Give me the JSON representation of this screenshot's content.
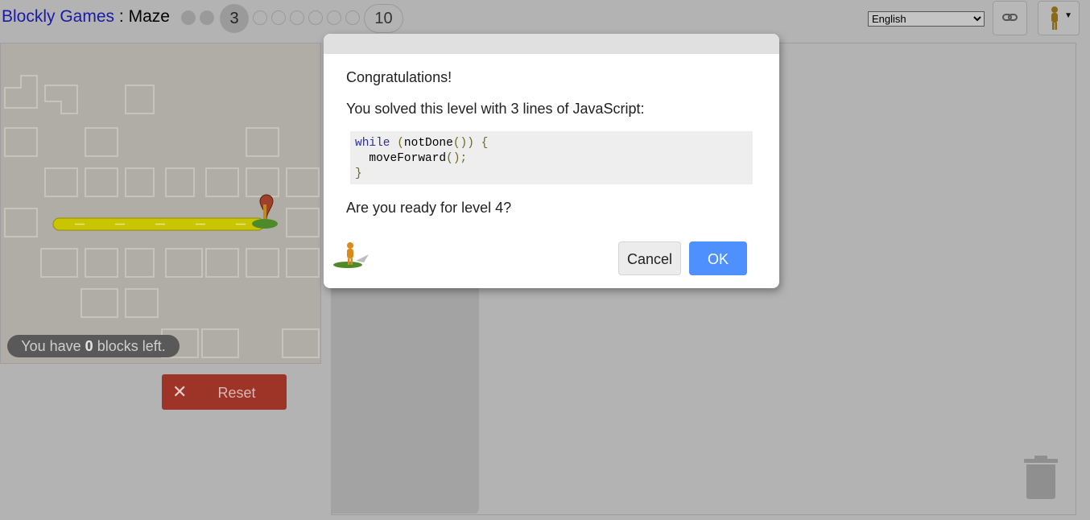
{
  "header": {
    "app_name": "Blockly Games",
    "separator": ":",
    "game_name": "Maze",
    "current_level": "3",
    "last_level": "10",
    "language_selected": "English"
  },
  "icons": {
    "link": "link-icon",
    "pegman": "pegman-icon",
    "trash": "trash-icon",
    "reset": "x-icon"
  },
  "maze": {
    "blocks_left_prefix": "You have",
    "blocks_left_count": "0",
    "blocks_left_suffix": "blocks left."
  },
  "controls": {
    "reset_label": "Reset"
  },
  "dialog": {
    "congrats": "Congratulations!",
    "solved": "You solved this level with 3 lines of JavaScript:",
    "code": {
      "kw_while": "while",
      "cond_open": "(",
      "cond_call": "notDone",
      "cond_parens": "()",
      "cond_close": ")",
      "brace_open": "{",
      "body_call": "moveForward",
      "body_parens": "();",
      "brace_close": "}"
    },
    "ready": "Are you ready for level 4?",
    "cancel_label": "Cancel",
    "ok_label": "OK"
  },
  "colors": {
    "path_yellow": "#d4d000",
    "ok_blue": "#4d90fe",
    "reset_red": "#9e3327",
    "keyword_blue": "#2e2e9e"
  }
}
